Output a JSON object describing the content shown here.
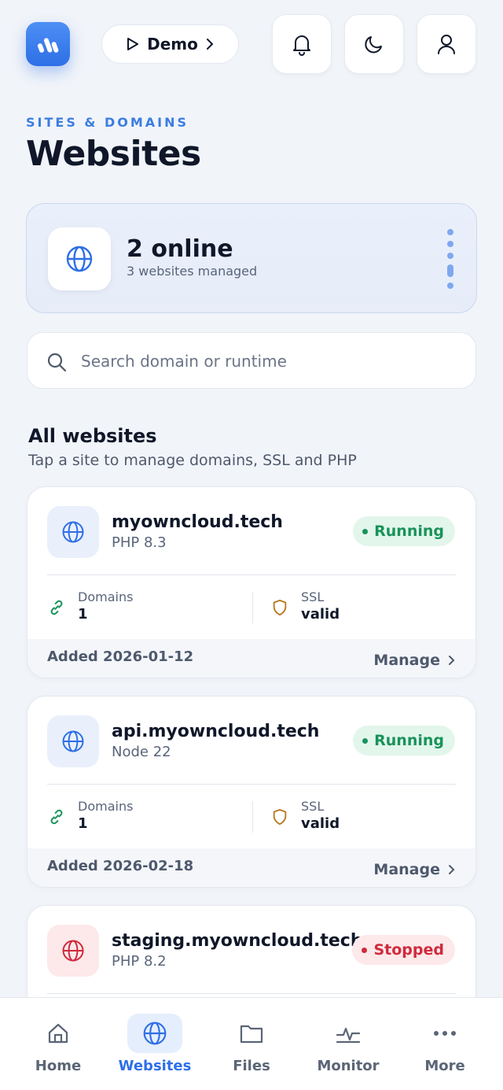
{
  "header": {
    "demo_label": "Demo",
    "icons": [
      "bell-icon",
      "moon-icon",
      "user-icon"
    ]
  },
  "page": {
    "eyebrow": "SITES & DOMAINS",
    "title": "Websites"
  },
  "summary": {
    "online": "2 online",
    "managed": "3 websites managed"
  },
  "search": {
    "placeholder": "Search domain or runtime"
  },
  "section": {
    "title": "All websites",
    "subtitle": "Tap a site to manage domains, SSL and PHP"
  },
  "sites": [
    {
      "domain": "myowncloud.tech",
      "runtime": "PHP 8.3",
      "status": "Running",
      "domains_label": "Domains",
      "domains_count": "1",
      "ssl_label": "SSL",
      "ssl_value": "valid",
      "added": "Added 2026-01-12",
      "manage": "Manage"
    },
    {
      "domain": "api.myowncloud.tech",
      "runtime": "Node 22",
      "status": "Running",
      "domains_label": "Domains",
      "domains_count": "1",
      "ssl_label": "SSL",
      "ssl_value": "valid",
      "added": "Added 2026-02-18",
      "manage": "Manage"
    },
    {
      "domain": "staging.myowncloud.tech",
      "runtime": "PHP 8.2",
      "status": "Stopped"
    }
  ],
  "nav": [
    {
      "label": "Home",
      "icon": "home-icon"
    },
    {
      "label": "Websites",
      "icon": "globe-icon",
      "active": true
    },
    {
      "label": "Files",
      "icon": "folder-icon"
    },
    {
      "label": "Monitor",
      "icon": "activity-icon"
    },
    {
      "label": "More",
      "icon": "more-icon"
    }
  ],
  "colors": {
    "accent": "#2e6fe6",
    "running": "#18935a",
    "stopped": "#cf2a3c",
    "background": "#f1f4f9"
  }
}
